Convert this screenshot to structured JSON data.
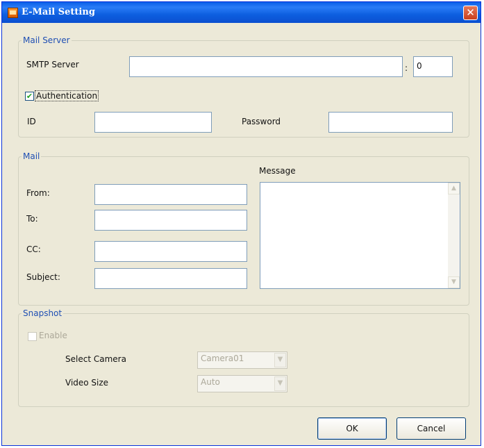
{
  "window": {
    "title": "E-Mail Setting"
  },
  "mail_server": {
    "legend": "Mail Server",
    "smtp_label": "SMTP Server",
    "smtp_value": "",
    "colon": ":",
    "port_value": "0",
    "auth_label": "Authentication",
    "auth_checked": true,
    "id_label": "ID",
    "id_value": "",
    "password_label": "Password",
    "password_value": ""
  },
  "mail": {
    "legend": "Mail",
    "message_label": "Message",
    "from_label": "From:",
    "to_label": "To:",
    "cc_label": "CC:",
    "subject_label": "Subject:",
    "from_value": "",
    "to_value": "",
    "cc_value": "",
    "subject_value": ""
  },
  "snapshot": {
    "legend": "Snapshot",
    "enable_label": "Enable",
    "enable_checked": false,
    "select_camera_label": "Select Camera",
    "camera_value": "Camera01",
    "video_size_label": "Video Size",
    "video_size_value": "Auto"
  },
  "buttons": {
    "ok": "OK",
    "cancel": "Cancel"
  },
  "icons": {
    "app": "email-setting-app-icon",
    "close": "close-icon",
    "check": "checkmark-icon",
    "scroll_up": "scroll-up-arrow-icon",
    "scroll_down": "scroll-down-arrow-icon",
    "dropdown": "chevron-down-icon"
  }
}
